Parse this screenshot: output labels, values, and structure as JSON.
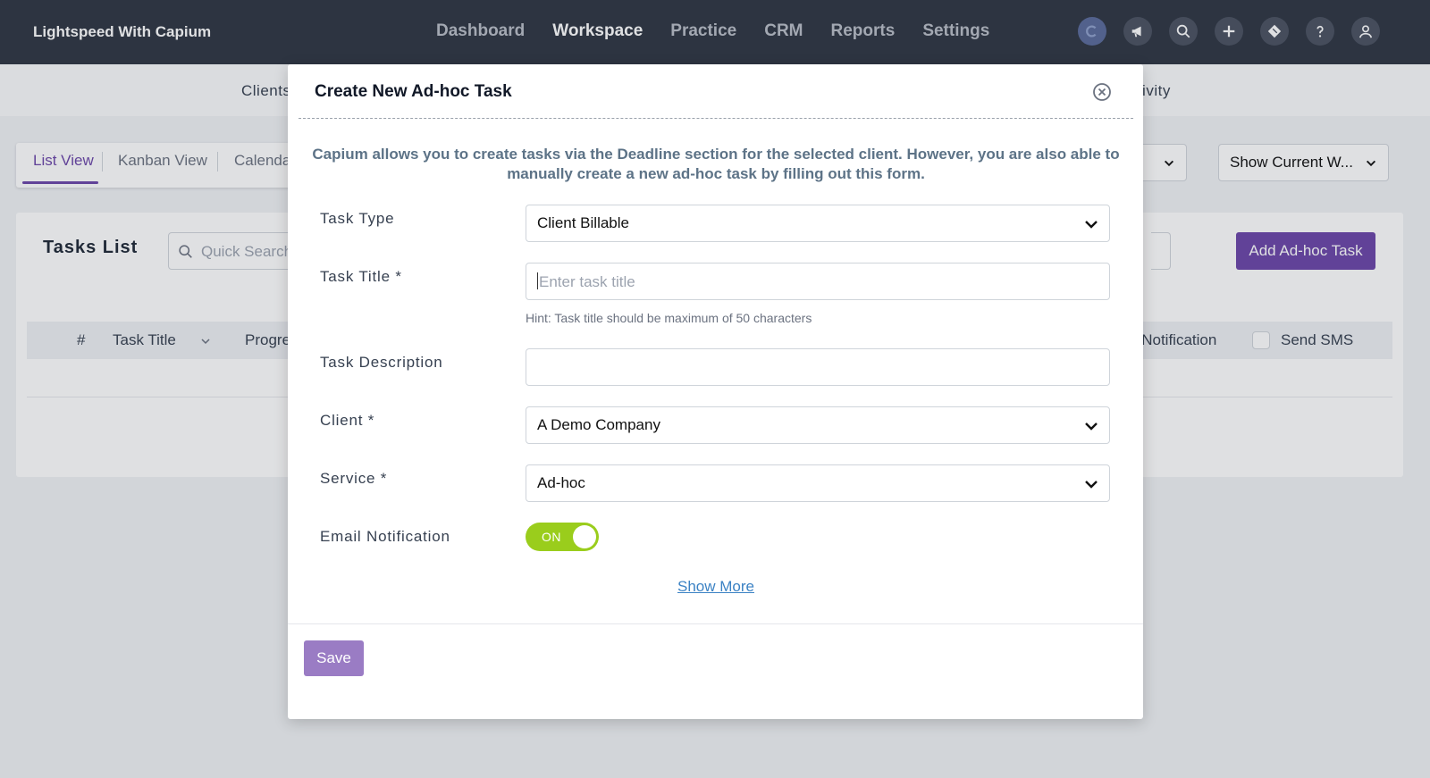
{
  "header": {
    "brand": "Lightspeed With Capium",
    "nav": [
      "Dashboard",
      "Workspace",
      "Practice",
      "CRM",
      "Reports",
      "Settings"
    ],
    "active_nav": "Workspace"
  },
  "subnav": {
    "left_text": "Clients",
    "right_text": "Activity"
  },
  "views": {
    "tabs": [
      "List View",
      "Kanban View",
      "Calendar"
    ],
    "active": "List View"
  },
  "filters": {
    "show_current": "Show Current W..."
  },
  "tasks": {
    "title": "Tasks List",
    "search_placeholder": "Quick Search",
    "add_button": "Add Ad-hoc Task",
    "columns": [
      "#",
      "Task Title",
      "Progress",
      "Email Notification",
      "Send SMS"
    ]
  },
  "modal": {
    "title": "Create New Ad-hoc Task",
    "info": "Capium allows you to create tasks via the Deadline section for the selected client. However, you are also able to manually create a new ad-hoc task by filling out this form.",
    "fields": {
      "task_type": {
        "label": "Task Type",
        "value": "Client Billable"
      },
      "task_title": {
        "label": "Task Title *",
        "placeholder": "Enter task title",
        "hint": "Hint: Task title should be maximum of 50 characters"
      },
      "task_description": {
        "label": "Task Description",
        "value": ""
      },
      "client": {
        "label": "Client *",
        "value": "A Demo Company"
      },
      "service": {
        "label": "Service *",
        "value": "Ad-hoc"
      },
      "email_notification": {
        "label": "Email Notification",
        "state": "ON"
      }
    },
    "show_more": "Show More",
    "save": "Save"
  }
}
